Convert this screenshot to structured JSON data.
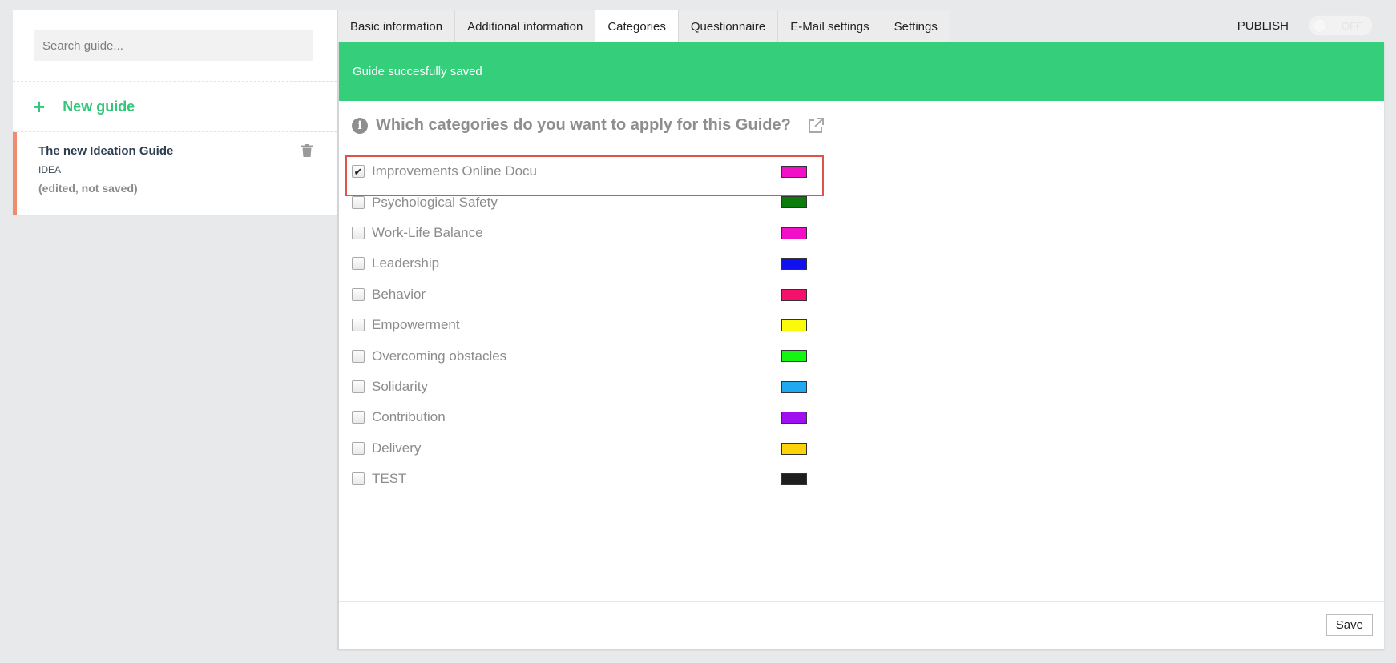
{
  "sidebar": {
    "search": {
      "placeholder": "Search guide..."
    },
    "new_guide_label": "New guide",
    "guide": {
      "title": "The new Ideation Guide",
      "type": "IDEA",
      "status": "(edited, not saved)"
    }
  },
  "tabs": [
    {
      "label": "Basic information"
    },
    {
      "label": "Additional information"
    },
    {
      "label": "Categories"
    },
    {
      "label": "Questionnaire"
    },
    {
      "label": "E-Mail settings"
    },
    {
      "label": "Settings"
    }
  ],
  "active_tab": "Categories",
  "publish": {
    "label": "PUBLISH",
    "toggle_label": "OFF"
  },
  "alert": {
    "message": "Guide succesfully saved",
    "color": "#35cf7b"
  },
  "question": "Which categories do you want to apply for this Guide?",
  "categories": [
    {
      "label": "Improvements Online Docu",
      "color": "#f20fc8",
      "checked": true,
      "highlighted": true
    },
    {
      "label": "Psychological Safety",
      "color": "#0b7d0b",
      "checked": false
    },
    {
      "label": "Work-Life Balance",
      "color": "#f20fc8",
      "checked": false
    },
    {
      "label": "Leadership",
      "color": "#1010f0",
      "checked": false
    },
    {
      "label": "Behavior",
      "color": "#f5106c",
      "checked": false
    },
    {
      "label": "Empowerment",
      "color": "#fafa0a",
      "checked": false
    },
    {
      "label": "Overcoming obstacles",
      "color": "#14f514",
      "checked": false
    },
    {
      "label": "Solidarity",
      "color": "#20a8f0",
      "checked": false
    },
    {
      "label": "Contribution",
      "color": "#a00ff0",
      "checked": false
    },
    {
      "label": "Delivery",
      "color": "#fcd20a",
      "checked": false
    },
    {
      "label": "TEST",
      "color": "#1e1e1e",
      "checked": false
    }
  ],
  "footer": {
    "save_label": "Save"
  }
}
